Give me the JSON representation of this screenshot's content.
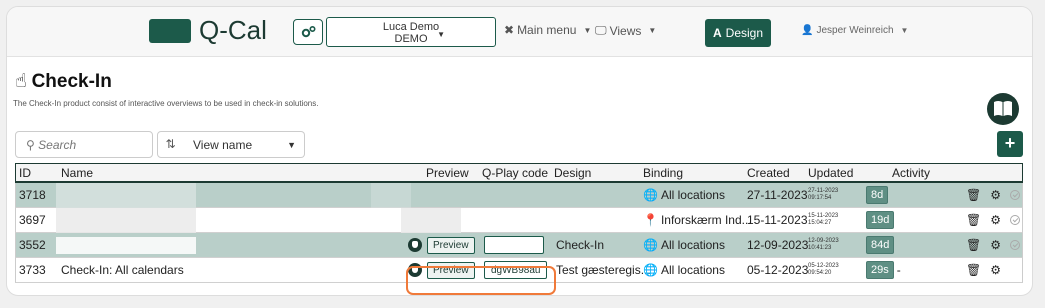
{
  "navbar": {
    "brand": "Q-Cal",
    "user_select": {
      "name": "Luca Demo",
      "org": "DEMO"
    },
    "main_menu": "Main menu",
    "views": "Views",
    "design": "Design",
    "user": "Jesper Weinreich"
  },
  "header": {
    "title": "Check-In",
    "description": "The Check-In product consist of interactive overviews to be used in check-in solutions."
  },
  "toolbar": {
    "search_placeholder": "Search",
    "view_select": "View name"
  },
  "table": {
    "columns": [
      "ID",
      "Name",
      "Preview",
      "Q-Play code",
      "Design",
      "Binding",
      "Created",
      "Updated",
      "Activity"
    ],
    "rows": [
      {
        "id": "3718",
        "name": "",
        "preview": "",
        "code": "",
        "design": "",
        "binding": "All locations",
        "binding_icon": "globe-icon",
        "created": "27-11-2023",
        "updated_date": "27-11-2023",
        "updated_time": "09:17:54",
        "age": "8d",
        "activity": ""
      },
      {
        "id": "3697",
        "name": "",
        "preview": "",
        "code": "",
        "design": "",
        "binding": "Inforskærm Ind...",
        "binding_icon": "map-pin-icon",
        "created": "15-11-2023",
        "updated_date": "15-11-2023",
        "updated_time": "15:04:27",
        "age": "19d",
        "activity": ""
      },
      {
        "id": "3552",
        "name": "",
        "preview": "Preview",
        "code": "",
        "design": "Check-In",
        "binding": "All locations",
        "binding_icon": "globe-icon",
        "created": "12-09-2023",
        "updated_date": "12-09-2023",
        "updated_time": "10:41:23",
        "age": "84d",
        "activity": ""
      },
      {
        "id": "3733",
        "name": "Check-In: All calendars",
        "preview": "Preview",
        "code": "dgWB98au",
        "design": "Test gæsteregis...",
        "binding": "All locations",
        "binding_icon": "globe-icon",
        "created": "05-12-2023",
        "updated_date": "05-12-2023",
        "updated_time": "09:54:20",
        "age": "29s",
        "activity": "-"
      }
    ]
  },
  "colors": {
    "primary": "#1c5a4a",
    "row_highlight": "#b9cfc9",
    "callout": "#f07a3a"
  }
}
